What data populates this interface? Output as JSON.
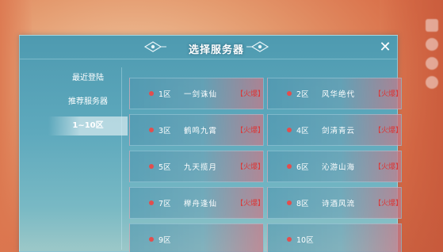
{
  "dialog": {
    "title": "选择服务器",
    "close_icon": "close-icon"
  },
  "sidebar": {
    "items": [
      {
        "label": "最近登陆",
        "active": false
      },
      {
        "label": "推荐服务器",
        "active": false
      },
      {
        "label": "1~10区",
        "active": true
      }
    ]
  },
  "servers": [
    {
      "zone": "1区",
      "name": "一剑诛仙",
      "status": "【火爆】"
    },
    {
      "zone": "2区",
      "name": "风华绝代",
      "status": "【火爆】"
    },
    {
      "zone": "3区",
      "name": "鹤鸣九霄",
      "status": "【火爆】"
    },
    {
      "zone": "4区",
      "name": "剑清青云",
      "status": "【火爆】"
    },
    {
      "zone": "5区",
      "name": "九天揽月",
      "status": "【火爆】"
    },
    {
      "zone": "6区",
      "name": "沁游山海",
      "status": "【火爆】"
    },
    {
      "zone": "7区",
      "name": "榉舟逢仙",
      "status": "【火爆】"
    },
    {
      "zone": "8区",
      "name": "诗酒风流",
      "status": "【火爆】"
    },
    {
      "zone": "9区",
      "name": "",
      "status": ""
    },
    {
      "zone": "10区",
      "name": "",
      "status": ""
    }
  ],
  "colors": {
    "status_hot": "#d93a3a",
    "dot": "#e24e4e"
  }
}
